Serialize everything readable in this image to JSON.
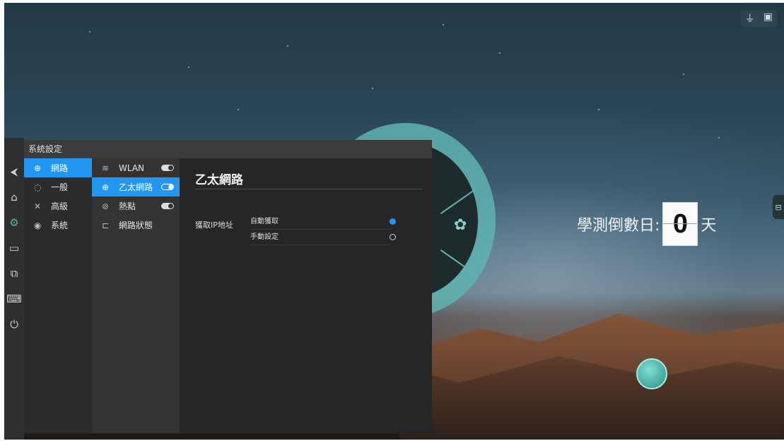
{
  "window": {
    "title": "系統設定"
  },
  "rail": {
    "icons": [
      "menu-icon",
      "back-icon",
      "home-icon",
      "gear-icon",
      "folder-icon",
      "screen-icon",
      "keyboard-icon",
      "power-icon"
    ],
    "active": "gear-icon"
  },
  "nav": {
    "items": [
      {
        "icon": "globe-icon",
        "label": "網路",
        "selected": true
      },
      {
        "icon": "palette-icon",
        "label": "一般",
        "selected": false
      },
      {
        "icon": "tools-icon",
        "label": "高級",
        "selected": false
      },
      {
        "icon": "circle-icon",
        "label": "系統",
        "selected": false
      }
    ]
  },
  "subnav": {
    "items": [
      {
        "icon": "wifi-icon",
        "label": "WLAN",
        "toggle": "off",
        "selected": false
      },
      {
        "icon": "globe-icon",
        "label": "乙太網路",
        "toggle": "on",
        "selected": true
      },
      {
        "icon": "hotspot-icon",
        "label": "熱點",
        "toggle": "off",
        "selected": false
      },
      {
        "icon": "status-icon",
        "label": "網路狀態",
        "toggle": null,
        "selected": false
      }
    ]
  },
  "panel": {
    "title": "乙太網路",
    "ip_label": "獲取IP地址",
    "options": [
      {
        "label": "自動獲取",
        "checked": true
      },
      {
        "label": "手動設定",
        "checked": false
      }
    ]
  },
  "desktop": {
    "countdown_prefix": "學測倒數日:",
    "countdown_value": "0",
    "countdown_suffix": "天",
    "accent_color": "#2196f3",
    "dial_color": "#5fb3b0"
  }
}
